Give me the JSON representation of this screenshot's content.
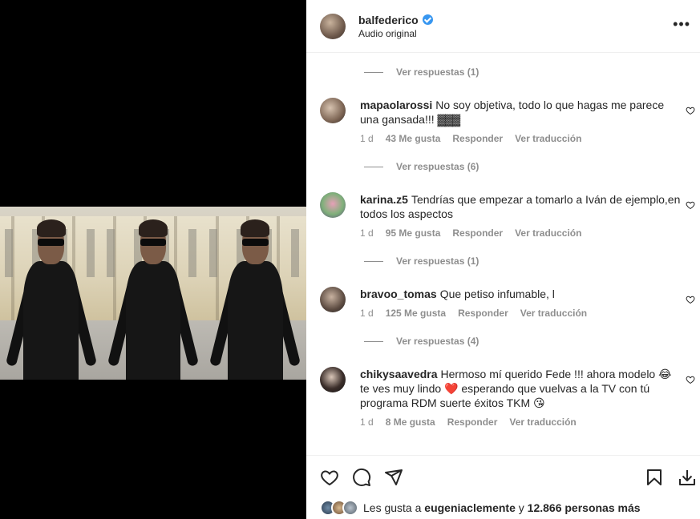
{
  "post": {
    "username": "balfederico",
    "subtitle": "Audio original",
    "more_icon": "more-horizontal-icon"
  },
  "replies_label_prefix": "Ver respuestas",
  "comments": [
    {
      "username": "mapaolarossi",
      "text": "No soy objetiva, todo lo que hagas me parece una gansada!!!",
      "emoji": "▓▓▓",
      "age": "1 d",
      "likes": "43 Me gusta",
      "reply": "Responder",
      "translate": "Ver traducción"
    },
    {
      "username": "karina.z5",
      "text": "Tendrías que empezar a tomarlo a Iván de ejemplo,en todos los aspectos",
      "age": "1 d",
      "likes": "95 Me gusta",
      "reply": "Responder",
      "translate": "Ver traducción"
    },
    {
      "username": "bravoo_tomas",
      "text": "Que petiso infumable, l",
      "age": "1 d",
      "likes": "125 Me gusta",
      "reply": "Responder",
      "translate": "Ver traducción"
    },
    {
      "username": "chikysaavedra",
      "text": "Hermoso mí querido Fede !!! ahora modelo 😂 te ves muy lindo ❤️ esperando que vuelvas a la TV con tú programa RDM suerte éxitos TKM 😘",
      "age": "1 d",
      "likes": "8 Me gusta",
      "reply": "Responder",
      "translate": "Ver traducción"
    }
  ],
  "replies": [
    {
      "label": "Ver respuestas (1)"
    },
    {
      "label": "Ver respuestas (6)"
    },
    {
      "label": "Ver respuestas (1)"
    },
    {
      "label": "Ver respuestas (4)"
    }
  ],
  "footer": {
    "likes_prefix": "Les gusta a",
    "likes_user": "eugeniaclemente",
    "likes_joiner": "y",
    "likes_count": "12.866 personas más"
  },
  "colors": {
    "heart_red": "#ed4956",
    "muted": "#8e8e8e",
    "verified_blue": "#3897f0"
  }
}
